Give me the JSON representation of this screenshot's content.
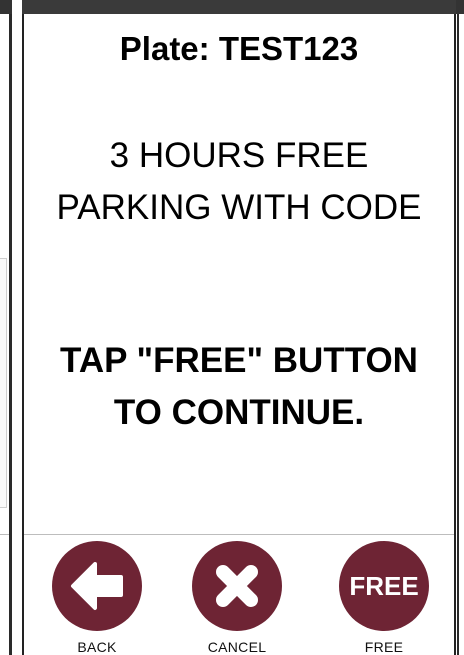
{
  "plate_display": "Plate: TEST123",
  "message_lines": [
    "3 HOURS FREE",
    "PARKING WITH CODE"
  ],
  "instruction_lines": [
    "TAP \"FREE\" BUTTON",
    "TO CONTINUE."
  ],
  "actions": [
    {
      "label": "BACK",
      "icon": "arrow-left-icon"
    },
    {
      "label": "CANCEL",
      "icon": "close-icon"
    },
    {
      "label": "FREE",
      "icon_text": "FREE"
    }
  ],
  "colors": {
    "accent": "#6e2434",
    "panel_bar": "#3a3a3a"
  }
}
